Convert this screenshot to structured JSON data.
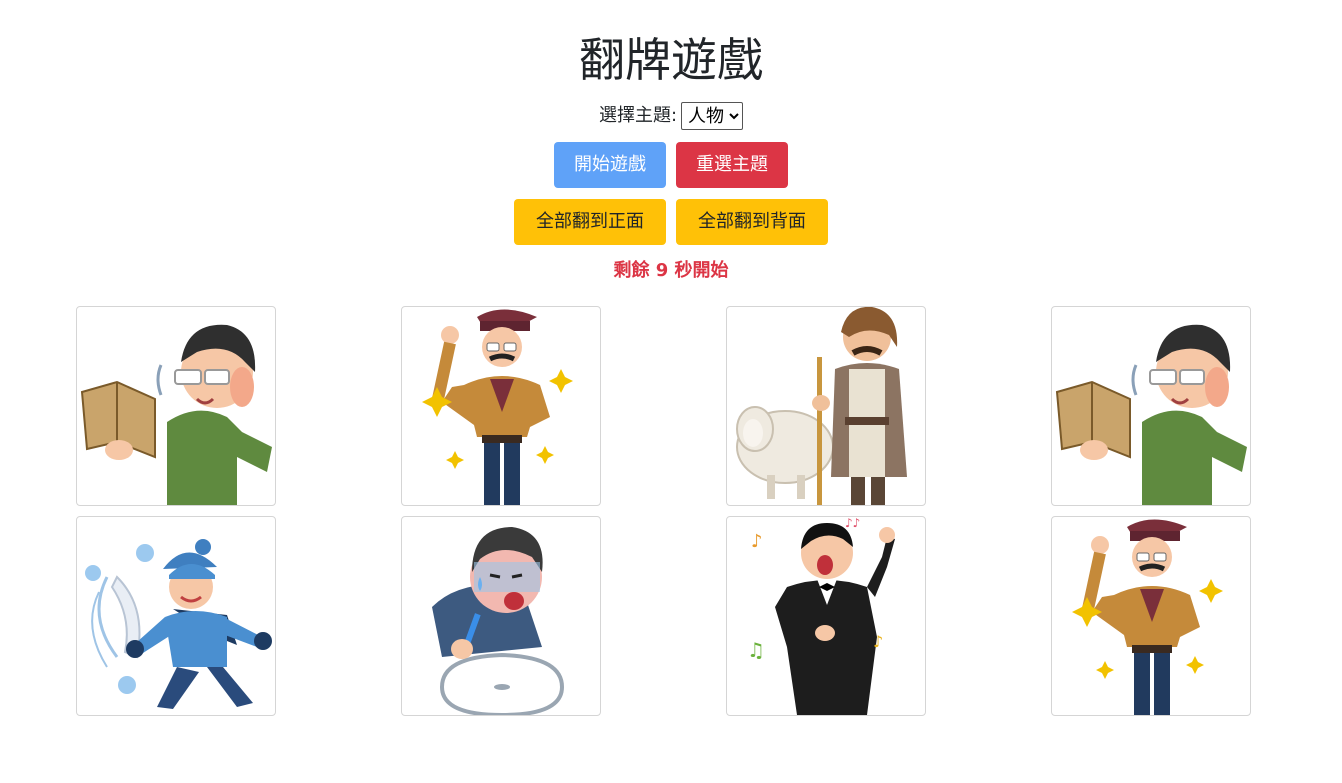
{
  "header": {
    "title": "翻牌遊戲"
  },
  "theme": {
    "label": "選擇主題:",
    "selected": "人物",
    "options": [
      "人物"
    ]
  },
  "controls": {
    "start_label": "開始遊戲",
    "reselect_label": "重選主題",
    "flip_front_label": "全部翻到正面",
    "flip_back_label": "全部翻到背面"
  },
  "status": {
    "countdown_text": "剩餘 9 秒開始"
  },
  "cards": [
    {
      "character": "reading-man",
      "state": "face-up"
    },
    {
      "character": "detective-man",
      "state": "face-up"
    },
    {
      "character": "shepherd",
      "state": "face-up"
    },
    {
      "character": "reading-man",
      "state": "face-up"
    },
    {
      "character": "cold-wind-person",
      "state": "face-up"
    },
    {
      "character": "sick-man-basin",
      "state": "face-up"
    },
    {
      "character": "opera-singer",
      "state": "face-up"
    },
    {
      "character": "detective-man",
      "state": "face-up"
    }
  ],
  "colors": {
    "primary": "#5fa2f8",
    "danger": "#dc3545",
    "warning": "#ffc107",
    "countdown": "#dc3545"
  }
}
